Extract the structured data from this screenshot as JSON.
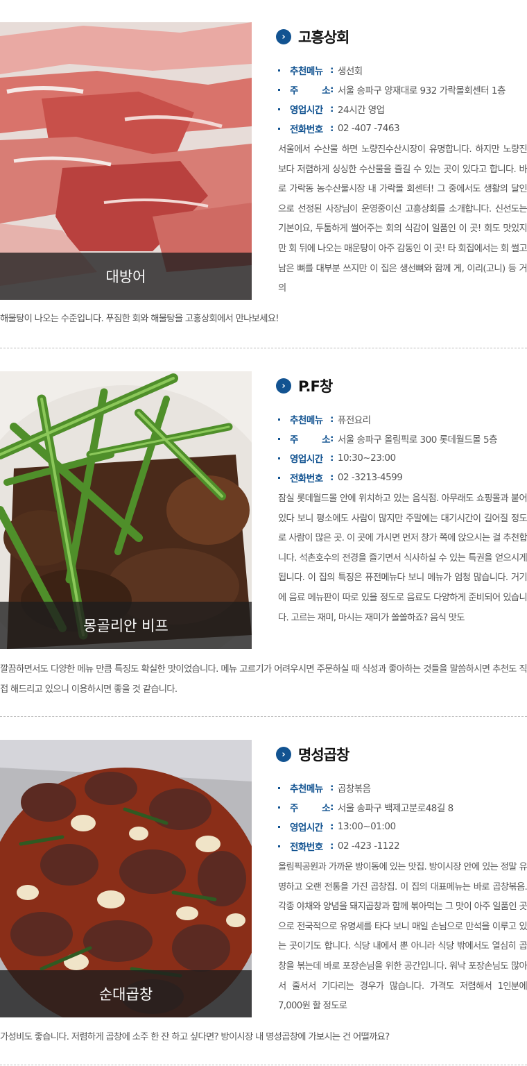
{
  "colors": {
    "accent": "#125391",
    "caption_bg": "#2b2b2b"
  },
  "labels": {
    "menu": "추천메뉴",
    "addr_1": "주",
    "addr_2": "소",
    "hours": "영업시간",
    "phone": "전화번호",
    "colon": ":"
  },
  "restaurants": [
    {
      "name": "고흥상회",
      "photo_caption": "대방어",
      "menu": "생선회",
      "address": "서울 송파구 양재대로 932 가락몰회센터 1층",
      "hours": "24시간 영업",
      "phone": "02 -407 -7463",
      "description_side": "서울에서 수산물 하면 노량진수산시장이 유명합니다. 하지만 노량진 보다 저렴하게 싱싱한 수산물을 즐길 수 있는 곳이 있다고 합니다. 바로 가락동 농수산물시장 내 가락몰 회센터! 그 중에서도 생활의 달인으로 선정된 사장님이 운영중이신 고흥상회를 소개합니다. 신선도는 기본이요, 두툼하게 썰어주는 회의 식감이 일품인 이 곳! 회도 맛있지만 회 뒤에 나오는 매운탕이 아주 감동인 이 곳! 타 회집에서는 회 썰고 남은 뼈를 대부분 쓰지만 이 집은 생선뼈와 함께 게, 이리(고니) 등 거의",
      "description_full": "해물탕이 나오는 수준입니다. 푸짐한 회와 해물탕을 고흥상회에서 만나보세요!"
    },
    {
      "name": "P.F창",
      "photo_caption": "몽골리안 비프",
      "menu": "퓨전요리",
      "address": "서울 송파구 올림픽로 300 롯데월드몰 5층",
      "hours": "10:30~23:00",
      "phone": "02 -3213-4599",
      "description_side": "잠실 롯데월드몰 안에 위치하고 있는 음식점. 아무래도 쇼핑몰과 붙어있다 보니 평소에도 사람이 많지만 주말에는 대기시간이 길어질 정도로 사람이 많은 곳. 이 곳에 가시면 먼저 창가 쪽에 앉으시는 걸 추천합니다. 석촌호수의 전경을 즐기면서 식사하실 수 있는 특권을 얻으시게 됩니다. 이 집의 특징은 퓨전메뉴다 보니 메뉴가 엄청 많습니다. 거기에 음료 메뉴판이 따로 있을 정도로 음료도 다양하게 준비되어 있습니다. 고르는 재미, 마시는 재미가 쏠쏠하죠? 음식 맛도",
      "description_full": "깔끔하면서도 다양한 메뉴 만큼 특징도 확실한 맛이었습니다. 메뉴 고르기가 어려우시면 주문하실 때 식성과 좋아하는 것들을 말씀하시면 추천도 직접 해드리고 있으니 이용하시면 좋을 것 같습니다."
    },
    {
      "name": "명성곱창",
      "photo_caption": "순대곱창",
      "menu": "곱창볶음",
      "address": "서울 송파구 백제고분로48길 8",
      "hours": "13:00~01:00",
      "phone": "02 -423 -1122",
      "description_side": "올림픽공원과 가까운 방이동에 있는 맛집. 방이시장 안에 있는 정말 유명하고 오랜 전통을 가진 곱창집. 이 집의 대표메뉴는 바로 곱창볶음. 각종 야채와 양념을 돼지곱창과 함께 볶아먹는 그 맛이 아주 일품인 곳으로 전국적으로 유명세를 타다 보니 매일 손님으로 만석을 이루고 있는 곳이기도 합니다. 식당 내에서 뿐 아니라 식당 밖에서도 열심히 곱창을 볶는데 바로 포장손님을 위한 공간입니다. 워낙 포장손님도 많아서 줄서서 기다리는 경우가 많습니다. 가격도 저렴해서 1인분에 7,000원 할 정도로",
      "description_full": "가성비도 좋습니다. 저렴하게 곱창에 소주 한 잔 하고 싶다면? 방이시장 내 명성곱창에 가보시는 건 어떨까요?"
    }
  ]
}
